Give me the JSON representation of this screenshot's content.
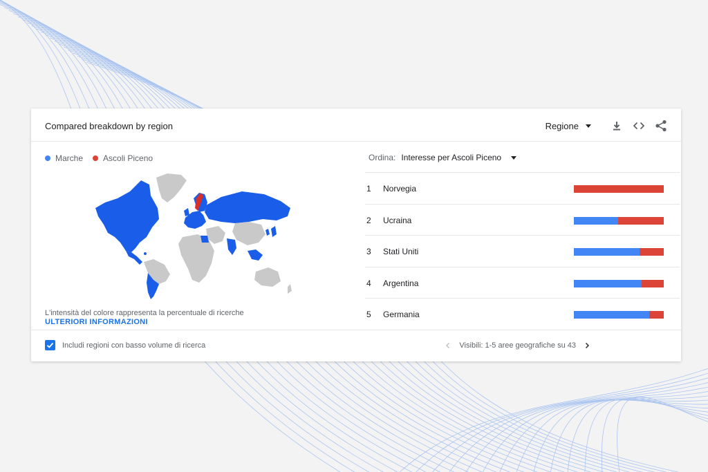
{
  "card": {
    "title": "Compared breakdown by region",
    "region_select": "Regione",
    "tools": [
      "download-icon",
      "embed-code-icon",
      "share-icon"
    ]
  },
  "legend": [
    {
      "label": "Marche",
      "color": "#4285f4"
    },
    {
      "label": "Ascoli Piceno",
      "color": "#db4437"
    }
  ],
  "map": {
    "note": "L'intensità del colore rappresenta la percentuale di ricerche",
    "more_link": "ULTERIORI INFORMAZIONI",
    "country_colors": {
      "marche": "#1a5de8",
      "ascoli": "#d93025",
      "none": "#c9c9c9"
    }
  },
  "sort": {
    "label": "Ordina:",
    "value": "Interesse per Ascoli Piceno"
  },
  "rankings": [
    {
      "rank": "1",
      "name": "Norvegia",
      "marche": 0,
      "ascoli": 100
    },
    {
      "rank": "2",
      "name": "Ucraina",
      "marche": 49,
      "ascoli": 51
    },
    {
      "rank": "3",
      "name": "Stati Uniti",
      "marche": 73,
      "ascoli": 27
    },
    {
      "rank": "4",
      "name": "Argentina",
      "marche": 75,
      "ascoli": 25
    },
    {
      "rank": "5",
      "name": "Germania",
      "marche": 84,
      "ascoli": 16
    }
  ],
  "footer": {
    "checkbox_label": "Includi regioni con basso volume di ricerca",
    "checkbox_checked": true,
    "pager_text": "Visibili: 1-5 aree geografiche su 43"
  }
}
